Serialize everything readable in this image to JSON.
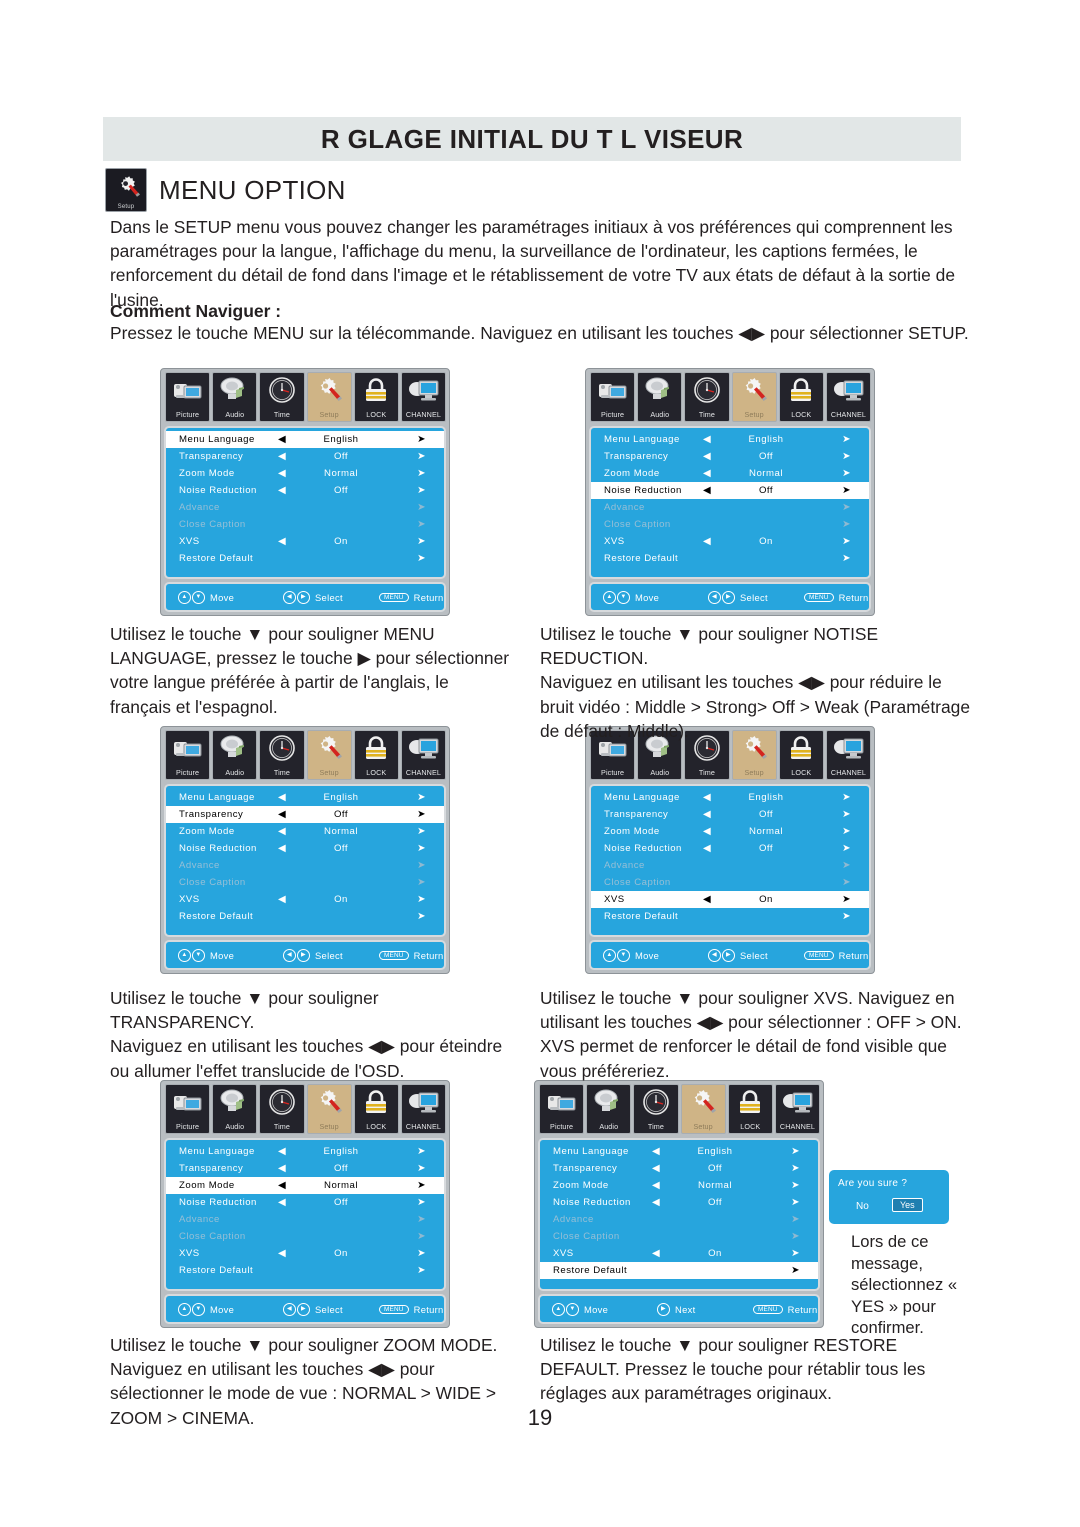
{
  "header": {
    "title": "R GLAGE INITIAL DU T L VISEUR",
    "section_title": "MENU OPTION",
    "section_icon_label": "Setup"
  },
  "intro": "Dans le SETUP menu vous pouvez changer les paramétrages initiaux à vos préférences qui comprennent les paramétrages pour la langue, l'affichage du menu, la surveillance de l'ordinateur, les captions fermées, le renforcement du détail de fond dans l'image et le rétablissement de votre TV aux états de défaut à la sortie de l'usine.",
  "howto": {
    "title": "Comment Naviguer :",
    "body": "Pressez le touche MENU sur la télécommande. Naviguez en utilisant les touches ◀▶ pour sélectionner SETUP."
  },
  "osd_tabs": [
    {
      "label": "Picture",
      "icon": "camcorder-icon"
    },
    {
      "label": "Audio",
      "icon": "speaker-note-icon"
    },
    {
      "label": "Time",
      "icon": "clock-icon"
    },
    {
      "label": "Setup",
      "icon": "gear-screwdriver-icon"
    },
    {
      "label": "LOCK",
      "icon": "padlock-icon"
    },
    {
      "label": "CHANNEL",
      "icon": "monitor-icon"
    }
  ],
  "osd_rows": [
    {
      "name": "Menu Language",
      "value": "English",
      "arrows": true
    },
    {
      "name": "Transparency",
      "value": "Off",
      "arrows": true
    },
    {
      "name": "Zoom Mode",
      "value": "Normal",
      "arrows": true
    },
    {
      "name": "Noise Reduction",
      "value": "Off",
      "arrows": true
    },
    {
      "name": "Advance",
      "value": "",
      "arrows": false,
      "dim": true
    },
    {
      "name": "Close Caption",
      "value": "",
      "arrows": false,
      "dim": true
    },
    {
      "name": "XVS",
      "value": "On",
      "arrows": true
    },
    {
      "name": "Restore Default",
      "value": "",
      "arrows": false
    }
  ],
  "osd_footer": {
    "move": "Move",
    "select": "Select",
    "next": "Next",
    "return": "Return",
    "menu_key": "MENU"
  },
  "osd_panels": [
    {
      "id": "osd-1",
      "selected_index": 0
    },
    {
      "id": "osd-2",
      "selected_index": 3
    },
    {
      "id": "osd-3",
      "selected_index": 1
    },
    {
      "id": "osd-4",
      "selected_index": 6
    },
    {
      "id": "osd-5",
      "selected_index": 2
    },
    {
      "id": "osd-6",
      "selected_index": 7
    }
  ],
  "captions": {
    "c1": "Utilisez le touche ▼ pour souligner MENU LANGUAGE, pressez le touche ▶ pour sélectionner votre langue préférée à partir de l'anglais, le français et l'espagnol.",
    "c2": "Utilisez le touche ▼ pour souligner NOTISE REDUCTION.\nNaviguez en utilisant les touches ◀▶ pour réduire le bruit vidéo : Middle > Strong> Off > Weak (Paramétrage de défaut : Middle).",
    "c3": "Utilisez le touche ▼ pour souligner TRANSPARENCY.\nNaviguez en utilisant les touches ◀▶ pour éteindre ou allumer l'effet translucide de l'OSD.",
    "c4": "Utilisez le touche ▼ pour souligner XVS. Naviguez en utilisant les touches ◀▶ pour sélectionner : OFF > ON. XVS permet de renforcer le détail de fond visible que vous préféreriez.",
    "c5": "Utilisez le touche ▼ pour souligner ZOOM MODE. Naviguez en utilisant les touches ◀▶ pour sélectionner le mode de vue : NORMAL > WIDE > ZOOM > CINEMA.",
    "c6": "Utilisez le touche ▼ pour souligner RESTORE DEFAULT. Pressez le touche pour rétablir tous les réglages aux paramétrages originaux."
  },
  "confirm_dialog": {
    "question": "Are  you sure ?",
    "no": "No",
    "yes": "Yes",
    "note": "Lors de ce message, sélectionnez « YES » pour confirmer."
  },
  "page_number": "19",
  "colors": {
    "osd_blue": "#27a5dd",
    "title_bar": "#e2e7e7",
    "tab_active": "#cfb486",
    "tab_dark": "#23232b"
  }
}
